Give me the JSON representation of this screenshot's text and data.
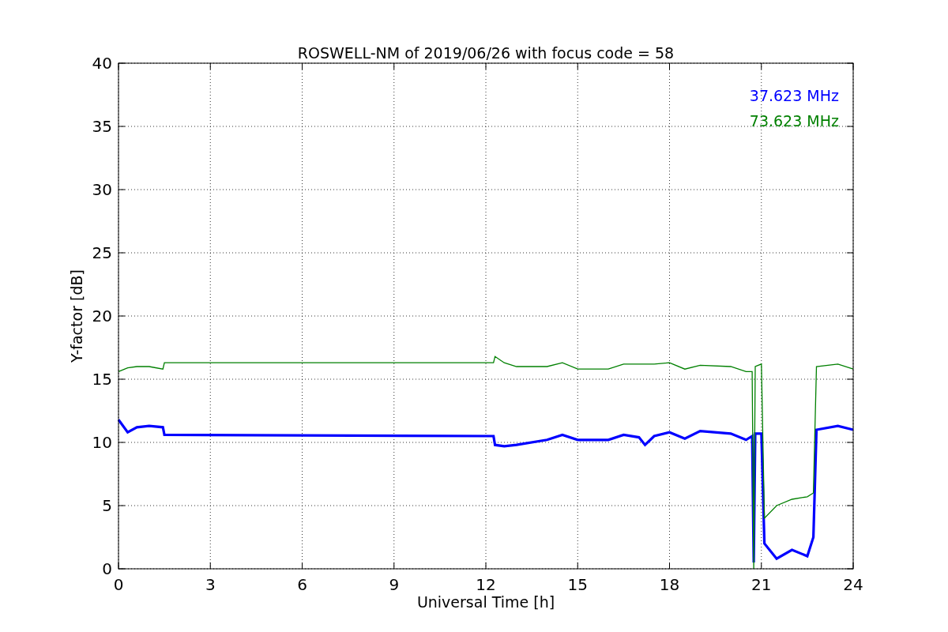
{
  "chart_data": {
    "type": "line",
    "title": "ROSWELL-NM of 2019/06/26 with focus code = 58",
    "xlabel": "Universal Time [h]",
    "ylabel": "Y-factor [dB]",
    "x": [
      0,
      0.3,
      0.6,
      1,
      1.45,
      1.5,
      12.25,
      12.3,
      12.6,
      13,
      14,
      14.5,
      15,
      16,
      16.5,
      17,
      17.2,
      17.5,
      18,
      18.5,
      19,
      20,
      20.5,
      20.7,
      20.75,
      20.8,
      21,
      21.1,
      21.5,
      22,
      22.5,
      22.7,
      22.8,
      23.5,
      24
    ],
    "series": [
      {
        "name": "37.623 MHz",
        "color": "#0000ff",
        "values": [
          11.8,
          10.8,
          11.2,
          11.3,
          11.2,
          10.6,
          10.5,
          9.8,
          9.7,
          9.8,
          10.2,
          10.6,
          10.2,
          10.2,
          10.6,
          10.4,
          9.8,
          10.5,
          10.8,
          10.3,
          10.9,
          10.7,
          10.2,
          10.5,
          0.5,
          10.7,
          10.7,
          2,
          0.8,
          1.5,
          1,
          2.5,
          11,
          11.3,
          11
        ]
      },
      {
        "name": "73.623 MHz",
        "color": "#008000",
        "values": [
          15.6,
          15.9,
          16,
          16,
          15.8,
          16.3,
          16.3,
          16.8,
          16.3,
          16,
          16,
          16.3,
          15.8,
          15.8,
          16.2,
          16.2,
          16.2,
          16.2,
          16.3,
          15.8,
          16.1,
          16,
          15.6,
          15.6,
          0,
          16,
          16.2,
          4,
          5,
          5.5,
          5.7,
          6,
          16,
          16.2,
          15.8
        ]
      }
    ],
    "grid": true,
    "xlim": [
      0,
      24
    ],
    "ylim": [
      0,
      40
    ],
    "xticks": [
      0,
      3,
      6,
      9,
      12,
      15,
      18,
      21,
      24
    ],
    "yticks": [
      0,
      5,
      10,
      15,
      20,
      25,
      30,
      35,
      40
    ]
  }
}
